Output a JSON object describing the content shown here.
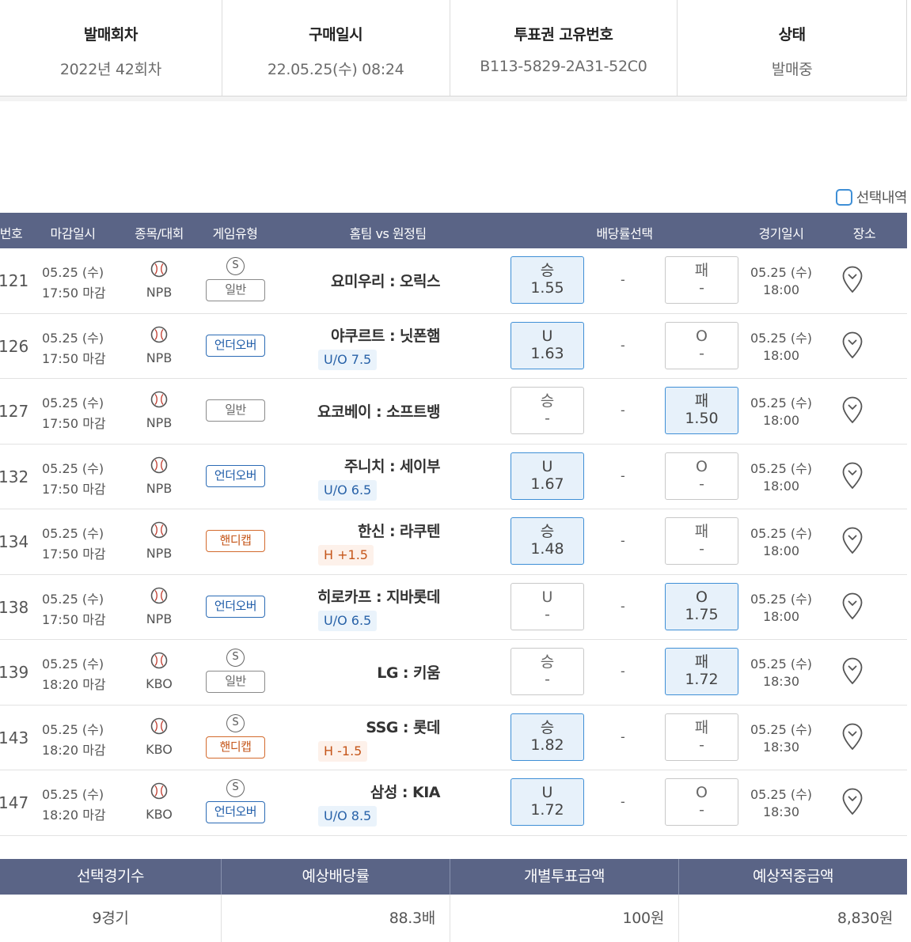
{
  "info": [
    {
      "label": "발매회차",
      "value": "2022년 42회차"
    },
    {
      "label": "구매일시",
      "value": "22.05.25(수) 08:24"
    },
    {
      "label": "투표권 고유번호",
      "value": "B113-5829-2A31-52C0"
    },
    {
      "label": "상태",
      "value": "발매중"
    }
  ],
  "select_history_label": "선택내역",
  "headers": {
    "num": "번호",
    "deadline": "마감일시",
    "sport": "종목/대회",
    "gametype": "게임유형",
    "teams": "홈팀 vs 원정팀",
    "odds": "배당률선택",
    "gamedate": "경기일시",
    "venue": "장소"
  },
  "colors": {
    "header_bg": "#5a6486",
    "selected_bg": "#e7f1fa",
    "selected_border": "#3f8fd6"
  },
  "rows": [
    {
      "num": "121",
      "d1": "05.25 (수)",
      "d2": "17:50 마감",
      "league": "NPB",
      "s": true,
      "type": "일반",
      "type_kind": "normal",
      "home": "요미우리",
      "sep": ":",
      "away": "오릭스",
      "sub": "",
      "oa": {
        "l": "승",
        "v": "1.55",
        "on": true
      },
      "dash": "-",
      "ob": {
        "l": "패",
        "v": "-",
        "on": false
      },
      "g1": "05.25 (수)",
      "g2": "18:00"
    },
    {
      "num": "126",
      "d1": "05.25 (수)",
      "d2": "17:50 마감",
      "league": "NPB",
      "s": false,
      "type": "언더오버",
      "type_kind": "uo",
      "home": "야쿠르트",
      "sep": ":",
      "away": "닛폰햄",
      "sub": "U/O 7.5",
      "sub_kind": "uo",
      "oa": {
        "l": "U",
        "v": "1.63",
        "on": true
      },
      "dash": "-",
      "ob": {
        "l": "O",
        "v": "-",
        "on": false
      },
      "g1": "05.25 (수)",
      "g2": "18:00"
    },
    {
      "num": "127",
      "d1": "05.25 (수)",
      "d2": "17:50 마감",
      "league": "NPB",
      "s": false,
      "type": "일반",
      "type_kind": "normal",
      "home": "요코베이",
      "sep": ":",
      "away": "소프트뱅",
      "sub": "",
      "oa": {
        "l": "승",
        "v": "-",
        "on": false
      },
      "dash": "-",
      "ob": {
        "l": "패",
        "v": "1.50",
        "on": true
      },
      "g1": "05.25 (수)",
      "g2": "18:00"
    },
    {
      "num": "132",
      "d1": "05.25 (수)",
      "d2": "17:50 마감",
      "league": "NPB",
      "s": false,
      "type": "언더오버",
      "type_kind": "uo",
      "home": "주니치",
      "sep": ":",
      "away": "세이부",
      "sub": "U/O 6.5",
      "sub_kind": "uo",
      "oa": {
        "l": "U",
        "v": "1.67",
        "on": true
      },
      "dash": "-",
      "ob": {
        "l": "O",
        "v": "-",
        "on": false
      },
      "g1": "05.25 (수)",
      "g2": "18:00"
    },
    {
      "num": "134",
      "d1": "05.25 (수)",
      "d2": "17:50 마감",
      "league": "NPB",
      "s": false,
      "type": "핸디캡",
      "type_kind": "hc",
      "home": "한신",
      "sep": ":",
      "away": "라쿠텐",
      "sub": "H +1.5",
      "sub_kind": "hc",
      "oa": {
        "l": "승",
        "v": "1.48",
        "on": true
      },
      "dash": "-",
      "ob": {
        "l": "패",
        "v": "-",
        "on": false
      },
      "g1": "05.25 (수)",
      "g2": "18:00"
    },
    {
      "num": "138",
      "d1": "05.25 (수)",
      "d2": "17:50 마감",
      "league": "NPB",
      "s": false,
      "type": "언더오버",
      "type_kind": "uo",
      "home": "히로카프",
      "sep": ":",
      "away": "지바롯데",
      "sub": "U/O 6.5",
      "sub_kind": "uo",
      "oa": {
        "l": "U",
        "v": "-",
        "on": false
      },
      "dash": "-",
      "ob": {
        "l": "O",
        "v": "1.75",
        "on": true
      },
      "g1": "05.25 (수)",
      "g2": "18:00"
    },
    {
      "num": "139",
      "d1": "05.25 (수)",
      "d2": "18:20 마감",
      "league": "KBO",
      "s": true,
      "type": "일반",
      "type_kind": "normal",
      "home": "LG",
      "sep": ":",
      "away": "키움",
      "sub": "",
      "oa": {
        "l": "승",
        "v": "-",
        "on": false
      },
      "dash": "-",
      "ob": {
        "l": "패",
        "v": "1.72",
        "on": true
      },
      "g1": "05.25 (수)",
      "g2": "18:30"
    },
    {
      "num": "143",
      "d1": "05.25 (수)",
      "d2": "18:20 마감",
      "league": "KBO",
      "s": true,
      "type": "핸디캡",
      "type_kind": "hc",
      "home": "SSG",
      "sep": ":",
      "away": "롯데",
      "sub": "H -1.5",
      "sub_kind": "hc",
      "oa": {
        "l": "승",
        "v": "1.82",
        "on": true
      },
      "dash": "-",
      "ob": {
        "l": "패",
        "v": "-",
        "on": false
      },
      "g1": "05.25 (수)",
      "g2": "18:30"
    },
    {
      "num": "147",
      "d1": "05.25 (수)",
      "d2": "18:20 마감",
      "league": "KBO",
      "s": true,
      "type": "언더오버",
      "type_kind": "uo",
      "home": "삼성",
      "sep": ":",
      "away": "KIA",
      "sub": "U/O 8.5",
      "sub_kind": "uo",
      "oa": {
        "l": "U",
        "v": "1.72",
        "on": true
      },
      "dash": "-",
      "ob": {
        "l": "O",
        "v": "-",
        "on": false
      },
      "g1": "05.25 (수)",
      "g2": "18:30"
    }
  ],
  "s_badge": "S",
  "summary": {
    "headers": [
      "선택경기수",
      "예상배당률",
      "개별투표금액",
      "예상적중금액"
    ],
    "values": [
      "9경기",
      "88.3배",
      "100원",
      "8,830원"
    ]
  }
}
